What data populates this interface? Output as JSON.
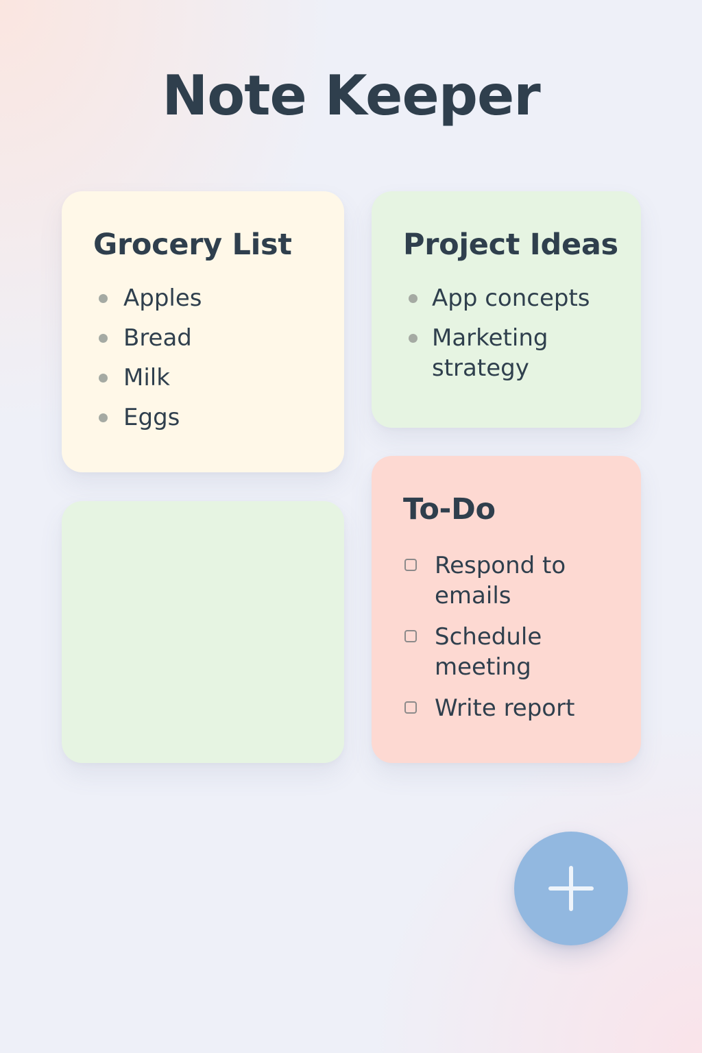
{
  "app": {
    "title": "Note Keeper"
  },
  "colors": {
    "grocery_card": "#fff8e8",
    "projects_card": "#e6f4e2",
    "empty_card": "#e6f4e2",
    "todo_card": "#fdd9d2",
    "fab": "#92b8e0",
    "text": "#2f3f4d"
  },
  "notes": {
    "grocery": {
      "title": "Grocery List",
      "items": [
        "Apples",
        "Bread",
        "Milk",
        "Eggs"
      ]
    },
    "projects": {
      "title": "Project Ideas",
      "items": [
        "App concepts",
        "Marketing strategy"
      ]
    },
    "empty": {
      "title": ""
    },
    "todo": {
      "title": "To-Do",
      "items": [
        {
          "label": "Respond to emails",
          "checked": false
        },
        {
          "label": "Schedule meeting",
          "checked": false
        },
        {
          "label": "Write report",
          "checked": false
        }
      ]
    }
  },
  "fab": {
    "icon": "plus-icon"
  }
}
